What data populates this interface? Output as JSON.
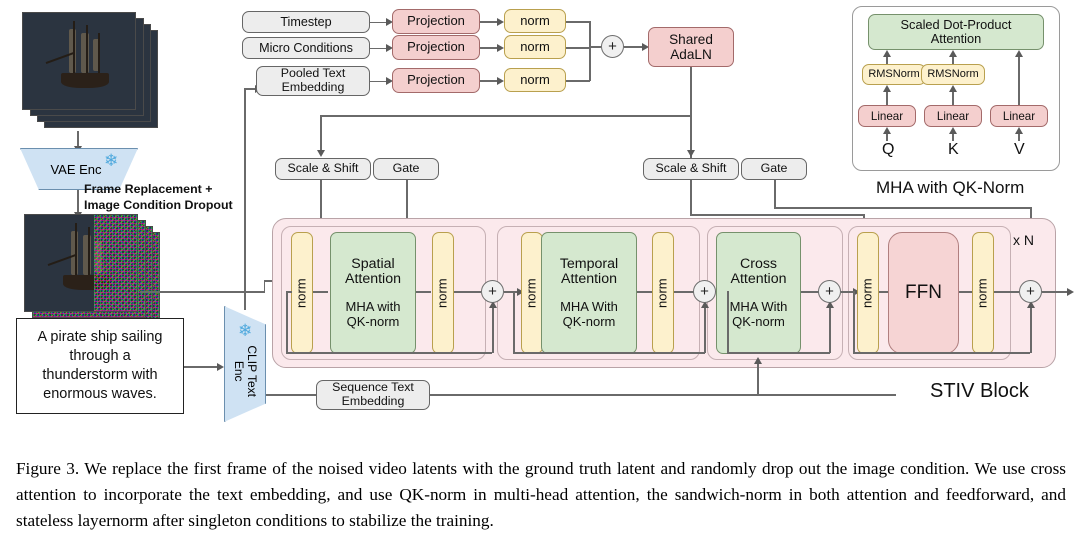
{
  "figure": {
    "number": "Figure 3.",
    "caption": "We replace the first frame of the noised video latents with the ground truth latent and randomly drop out the image condition. We use cross attention to incorporate the text embedding, and use QK-norm in multi-head attention, the sandwich-norm in both attention and feedforward, and stateless layernorm after singleton conditions to stabilize the training."
  },
  "left": {
    "video_frames_label": "",
    "vae_encoder": "VAE Enc",
    "frame_replacement_note_line1": "Frame Replacement +",
    "frame_replacement_note_line2": "Image Condition Dropout",
    "prompt_text": "A pirate ship sailing through a thunderstorm with enormous waves.",
    "clip_text_encoder_line1": "CLIP Text",
    "clip_text_encoder_line2": "Enc",
    "snowflake_icon": "snowflake-icon"
  },
  "conditioning": {
    "inputs": [
      {
        "label": "Timestep"
      },
      {
        "label": "Micro Conditions"
      },
      {
        "label": "Pooled Text Embedding"
      }
    ],
    "projection_label": "Projection",
    "norm_label": "norm",
    "sum_symbol": "+",
    "shared_adaln_line1": "Shared",
    "shared_adaln_line2": "AdaLN"
  },
  "modulation": {
    "scale_shift_label": "Scale & Shift",
    "gate_label": "Gate"
  },
  "stiv_block": {
    "title": "STIV Block",
    "repeat_label": "x N",
    "norm_label": "norm",
    "sum_symbol": "+",
    "sequence_text_embedding_line1": "Sequence Text",
    "sequence_text_embedding_line2": "Embedding",
    "ffn_label": "FFN",
    "attentions": [
      {
        "name_line1": "Spatial",
        "name_line2": "Attention",
        "sub_line1": "MHA with",
        "sub_line2": "QK-norm"
      },
      {
        "name_line1": "Temporal",
        "name_line2": "Attention",
        "sub_line1": "MHA With",
        "sub_line2": "QK-norm"
      },
      {
        "name_line1": "Cross",
        "name_line2": "Attention",
        "sub_line1": "MHA With",
        "sub_line2": "QK-norm"
      }
    ]
  },
  "mha_panel": {
    "title": "MHA with QK-Norm",
    "attention_line1": "Scaled Dot-Product",
    "attention_line2": "Attention",
    "rmsnorm_label": "RMSNorm",
    "linear_label": "Linear",
    "inputs": [
      "Q",
      "K",
      "V"
    ]
  },
  "colors": {
    "pink": "#f4cfce",
    "yellow": "#fdf1cd",
    "green": "#d5e8cf",
    "blue": "#cfe2f3",
    "gray": "#ededed",
    "stiv_bg": "#fbe9ec",
    "ffn": "#f6d4d4",
    "line": "#6a6a6a"
  }
}
